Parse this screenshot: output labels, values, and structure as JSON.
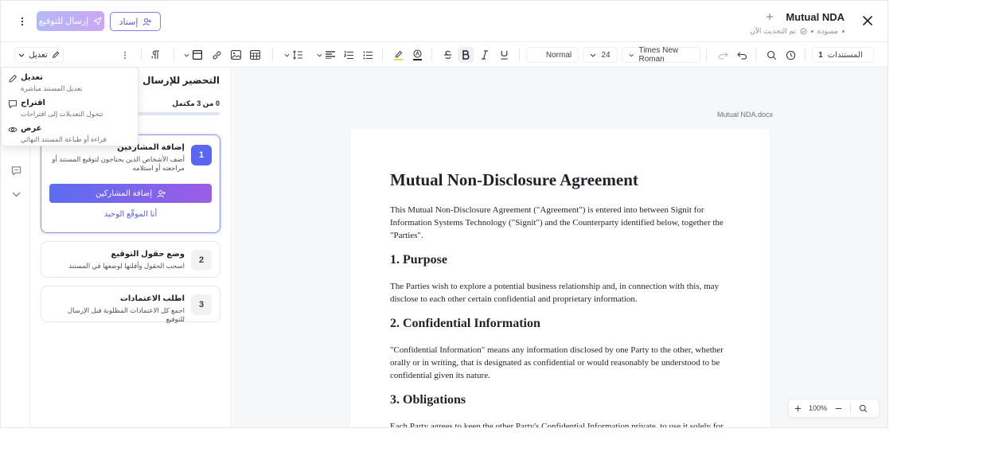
{
  "header": {
    "title": "Mutual NDA",
    "status": "مسودة",
    "saved": "تم التحديث الآن",
    "send_label": "إرسال للتوقيع",
    "assign_label": "إسناد"
  },
  "toolbar": {
    "documents_label": "المستندات",
    "documents_count": "1",
    "font_family": "Times New Roman",
    "font_size": "24",
    "style": "Normal",
    "mode_label": "تعديل"
  },
  "mode_menu": {
    "items": [
      {
        "label": "تعديل",
        "desc": "تعديل المستند مباشرة"
      },
      {
        "label": "اقتراح",
        "desc": "تتحول التعديلات إلى اقتراحات"
      },
      {
        "label": "عرض",
        "desc": "قراءة أو طباعة المستند النهائي"
      }
    ]
  },
  "panel": {
    "title": "التحضير للإرسال",
    "progress_label": "0 من 3 مكتمل",
    "progress_value": 0.03,
    "steps": [
      {
        "num": "1",
        "title": "إضافة المشاركين",
        "desc": "أضف الأشخاص الذين يحتاجون لتوقيع المستند أو مراجعته أو استلامه",
        "button": "إضافة المشاركين",
        "link": "أنا الموقّع الوحيد"
      },
      {
        "num": "2",
        "title": "وضع حقول التوقيع",
        "desc": "اسحب الحقول وأفلتها لوضعها في المستند"
      },
      {
        "num": "3",
        "title": "اطلب الاعتمادات",
        "desc": "اجمع كل الاعتمادات المطلوبة قبل الإرسال للتوقيع"
      }
    ]
  },
  "document": {
    "file_name": "Mutual NDA.docx",
    "title": "Mutual Non-Disclosure Agreement",
    "intro": "This Mutual Non-Disclosure Agreement (\"Agreement\") is entered into between Signit for Information Systems Technology (\"Signit\") and the Counterparty identified below, together the \"Parties\".",
    "s1_title": "1. Purpose",
    "s1_body": "The Parties wish to explore a potential business relationship and, in connection with this, may disclose to each other certain confidential and proprietary information.",
    "s2_title": "2. Confidential Information",
    "s2_body": "\"Confidential Information\" means any information disclosed by one Party to the other, whether orally or in writing, that is designated as confidential or would reasonably be understood to be confidential given its nature.",
    "s3_title": "3. Obligations",
    "s3_body": "Each Party agrees to keep the other Party's Confidential Information private, to use it solely for the"
  },
  "zoom": {
    "level": "100%"
  },
  "colors": {
    "accent": "#5b66f0",
    "accent2": "#9b5de5"
  }
}
